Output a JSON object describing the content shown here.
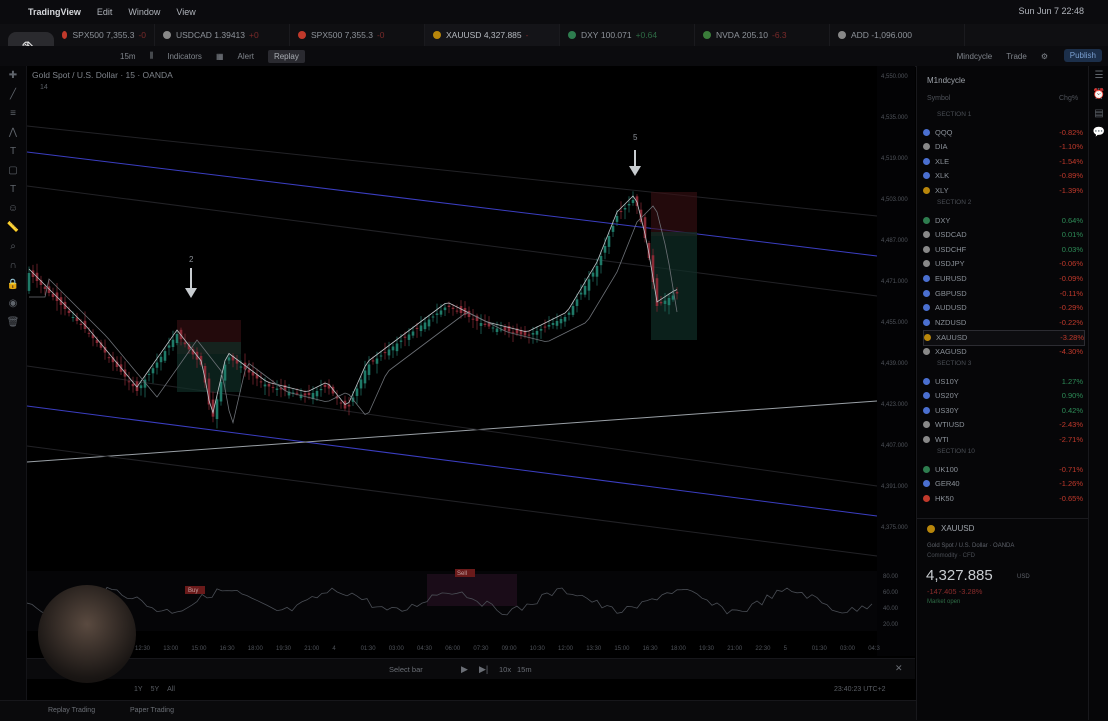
{
  "menubar": {
    "app": "TradingView",
    "items": [
      "Edit",
      "Window",
      "View"
    ],
    "datetime": "Sun Jun 7  22:48"
  },
  "tabs": [
    {
      "symbol": "SPX500",
      "price": "7,355.3",
      "change": "-0",
      "color": "#c0392b"
    },
    {
      "symbol": "USDCAD",
      "price": "1.39413",
      "change": "+0",
      "color": "#888888"
    },
    {
      "symbol": "SPX500",
      "price": "7,355.3",
      "change": "-0",
      "color": "#c0392b"
    },
    {
      "symbol": "XAUUSD",
      "price": "4,327.885",
      "change": "-",
      "color": "#b8860b"
    },
    {
      "symbol": "DXY",
      "price": "100.071",
      "change": "+0.64",
      "color": "#2e7d4f"
    },
    {
      "symbol": "NVDA",
      "price": "205.10",
      "change": "-6.3",
      "color": "#3a7d3a"
    },
    {
      "symbol": "ADD",
      "price": "-1,096.000",
      "change": "",
      "color": "#888888"
    }
  ],
  "toolbar": {
    "interval": "15m",
    "indicators": "Indicators",
    "alert": "Alert",
    "replay": "Replay",
    "layout": "Mindcycle",
    "trade": "Trade",
    "publish": "Publish"
  },
  "chart": {
    "symbol_title": "Gold Spot / U.S. Dollar · 15 · OANDA",
    "indicator_label": "14",
    "arrow_labels": [
      "2",
      "5"
    ],
    "price_ticks": [
      "4,550.000",
      "4,535.000",
      "4,519.000",
      "4,503.000",
      "4,487.000",
      "4,471.000",
      "4,455.000",
      "4,439.000",
      "4,423.000",
      "4,407.000",
      "4,391.000",
      "4,375.000"
    ],
    "osc_ticks": [
      "80.00",
      "60.00",
      "40.00",
      "20.00"
    ],
    "time_ticks": [
      "12:30",
      "13:00",
      "15:00",
      "16:30",
      "18:00",
      "19:30",
      "21:00",
      "4",
      "01:30",
      "03:00",
      "04:30",
      "06:00",
      "07:30",
      "09:00",
      "10:30",
      "12:00",
      "13:30",
      "15:00",
      "16:30",
      "18:00",
      "19:30",
      "21:00",
      "22:30",
      "5",
      "01:30",
      "03:00",
      "04:3"
    ],
    "osc_label_left": "Buy",
    "osc_label_mid": "Sell"
  },
  "replay_bar": {
    "select_bar": "Select bar",
    "speed": "10x",
    "interval": "15m"
  },
  "bottom": {
    "ranges": [
      "1Y",
      "5Y",
      "All"
    ],
    "clock": "23:40:23 UTC+2",
    "replay_trading": "Replay Trading",
    "paper_trading": "Paper Trading"
  },
  "watchlist": {
    "title": "M1ndcycle",
    "col_symbol": "Symbol",
    "col_chg": "Chg%",
    "sections": [
      "SECTION 1",
      "SECTION 2",
      "SECTION 3",
      "SECTION 10"
    ],
    "rows": [
      {
        "name": "QQQ",
        "chg": "-0.82%",
        "color": "#c0392b",
        "icon": "#4a6fd0"
      },
      {
        "name": "DIA",
        "chg": "-1.10%",
        "color": "#c0392b",
        "icon": "#888888"
      },
      {
        "name": "XLE",
        "chg": "-1.54%",
        "color": "#c0392b",
        "icon": "#4a6fd0"
      },
      {
        "name": "XLK",
        "chg": "-0.89%",
        "color": "#c0392b",
        "icon": "#4a6fd0"
      },
      {
        "name": "XLY",
        "chg": "-1.39%",
        "color": "#c0392b",
        "icon": "#b8860b"
      },
      {
        "name": "DXY",
        "chg": "0.64%",
        "color": "#2e8b57",
        "icon": "#2e7d4f"
      },
      {
        "name": "USDCAD",
        "chg": "0.01%",
        "color": "#2e8b57",
        "icon": "#888888"
      },
      {
        "name": "USDCHF",
        "chg": "0.03%",
        "color": "#2e8b57",
        "icon": "#888888"
      },
      {
        "name": "USDJPY",
        "chg": "-0.06%",
        "color": "#c0392b",
        "icon": "#888888"
      },
      {
        "name": "EURUSD",
        "chg": "-0.09%",
        "color": "#c0392b",
        "icon": "#4a6fd0"
      },
      {
        "name": "GBPUSD",
        "chg": "-0.11%",
        "color": "#c0392b",
        "icon": "#4a6fd0"
      },
      {
        "name": "AUDUSD",
        "chg": "-0.29%",
        "color": "#c0392b",
        "icon": "#4a6fd0"
      },
      {
        "name": "NZDUSD",
        "chg": "-0.22%",
        "color": "#c0392b",
        "icon": "#4a6fd0"
      },
      {
        "name": "XAUUSD",
        "chg": "-3.28%",
        "color": "#c0392b",
        "icon": "#b8860b"
      },
      {
        "name": "XAGUSD",
        "chg": "-4.30%",
        "color": "#c0392b",
        "icon": "#888888"
      },
      {
        "name": "US10Y",
        "chg": "1.27%",
        "color": "#2e8b57",
        "icon": "#4a6fd0"
      },
      {
        "name": "US20Y",
        "chg": "0.90%",
        "color": "#2e8b57",
        "icon": "#4a6fd0"
      },
      {
        "name": "US30Y",
        "chg": "0.42%",
        "color": "#2e8b57",
        "icon": "#4a6fd0"
      },
      {
        "name": "WTIUSD",
        "chg": "-2.43%",
        "color": "#c0392b",
        "icon": "#888888"
      },
      {
        "name": "WTI",
        "chg": "-2.71%",
        "color": "#c0392b",
        "icon": "#888888"
      },
      {
        "name": "UK100",
        "chg": "-0.71%",
        "color": "#c0392b",
        "icon": "#2e7d4f"
      },
      {
        "name": "GER40",
        "chg": "-1.26%",
        "color": "#c0392b",
        "icon": "#4a6fd0"
      },
      {
        "name": "HK50",
        "chg": "-0.65%",
        "color": "#c0392b",
        "icon": "#c0392b"
      }
    ]
  },
  "details": {
    "symbol": "XAUUSD",
    "desc": "Gold Spot / U.S. Dollar · OANDA",
    "type": "Commodity · CFD",
    "price": "4,327.885",
    "currency": "USD",
    "change": "-147.405  -3.28%",
    "market": "Market open"
  }
}
